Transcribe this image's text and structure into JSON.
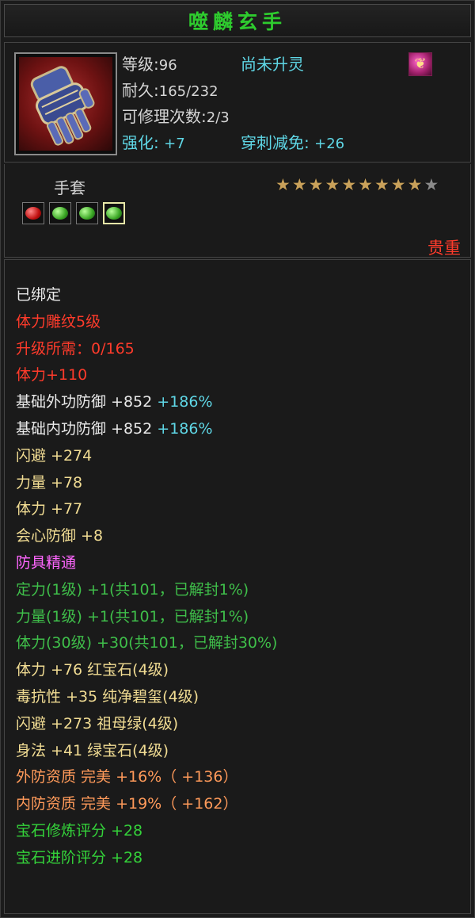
{
  "title": "噬麟玄手",
  "header": {
    "level_label": "等级",
    "level_value": "96",
    "spirit_status": "尚未升灵",
    "durability_label": "耐久",
    "durability_value": "165/232",
    "repair_label": "可修理次数",
    "repair_value": "2/3",
    "enhance_label": "强化:",
    "enhance_value": "+7",
    "pierce_label": "穿刺减免:",
    "pierce_value": "+26",
    "soul_icon": "spirit-rune-icon"
  },
  "info": {
    "category": "手套",
    "stars_filled": 9,
    "stars_total": 10,
    "gem_slots": [
      "red-gem",
      "green-gem",
      "green-gem",
      "green-gem"
    ],
    "rarity": "贵重"
  },
  "attributes": [
    {
      "text": "已绑定",
      "color": "white"
    },
    {
      "text": "体力雕纹5级",
      "color": "red"
    },
    {
      "text": "升级所需：0/165",
      "color": "red"
    },
    {
      "text": "体力+110",
      "color": "red"
    },
    {
      "text": "基础外功防御 +852",
      "extra": " +186%",
      "color": "white",
      "extra_color": "cyan"
    },
    {
      "text": "基础内功防御 +852",
      "extra": " +186%",
      "color": "white",
      "extra_color": "cyan"
    },
    {
      "text": "闪避 +274",
      "color": "yellow"
    },
    {
      "text": "力量 +78",
      "color": "yellow"
    },
    {
      "text": "体力 +77",
      "color": "yellow"
    },
    {
      "text": "会心防御 +8",
      "color": "yellow"
    },
    {
      "text": "防具精通",
      "color": "pink"
    },
    {
      "text": "定力(1级) +1(共101，已解封1%)",
      "color": "green"
    },
    {
      "text": "力量(1级) +1(共101，已解封1%)",
      "color": "green"
    },
    {
      "text": "体力(30级) +30(共101，已解封30%)",
      "color": "green"
    },
    {
      "text": "体力 +76 红宝石(4级)",
      "color": "yellow"
    },
    {
      "text": "毒抗性 +35 纯净碧玺(4级)",
      "color": "yellow"
    },
    {
      "text": "闪避 +273 祖母绿(4级)",
      "color": "yellow"
    },
    {
      "text": "身法 +41 绿宝石(4级)",
      "color": "yellow"
    },
    {
      "text": "外防资质   完美 +16%（ +136）",
      "color": "orange"
    },
    {
      "text": "内防资质   完美 +19%（ +162）",
      "color": "orange"
    },
    {
      "text": "宝石修炼评分 +28",
      "color": "bright-green"
    },
    {
      "text": "宝石进阶评分 +28",
      "color": "bright-green"
    }
  ],
  "colors": {
    "title_green": "#2ecb2e",
    "cyan": "#5fd7e6",
    "red": "#ff3b2b",
    "yellow": "#f1dc93",
    "green": "#3fbf4a",
    "pink": "#ff66ff",
    "orange": "#ff9a5a"
  }
}
